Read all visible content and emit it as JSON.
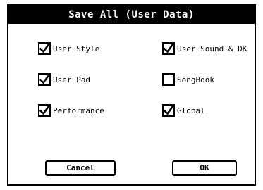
{
  "dialog": {
    "title": "Save All (User Data)"
  },
  "options": [
    {
      "label": "User Style",
      "checked": true
    },
    {
      "label": "User Sound & DK",
      "checked": true
    },
    {
      "label": "User Pad",
      "checked": true
    },
    {
      "label": "SongBook",
      "checked": false
    },
    {
      "label": "Performance",
      "checked": true
    },
    {
      "label": "Global",
      "checked": true
    }
  ],
  "buttons": {
    "cancel_label": "Cancel",
    "ok_label": "OK"
  }
}
